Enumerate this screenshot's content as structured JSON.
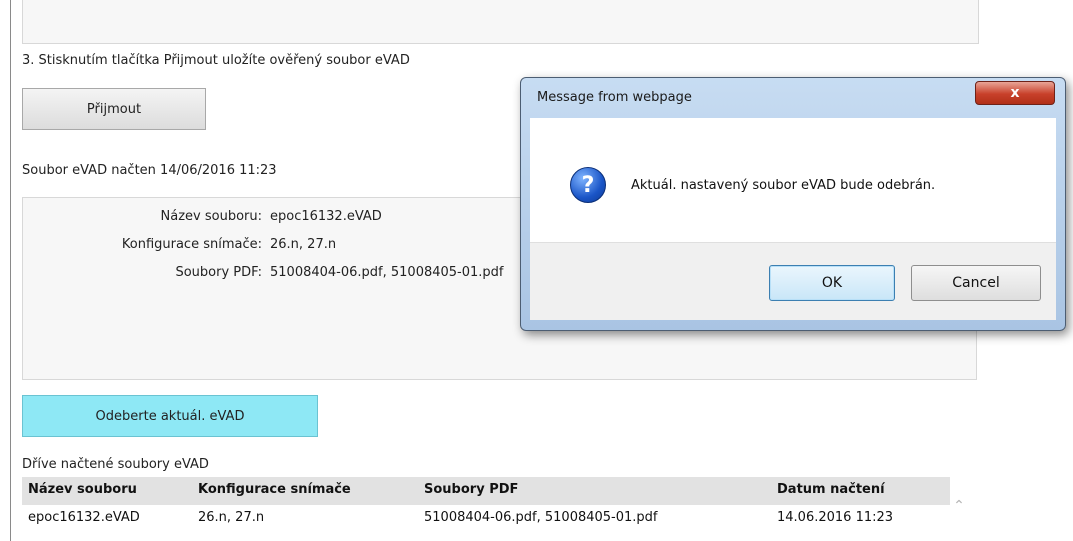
{
  "page": {
    "step3_text": "3. Stisknutím tlačítka Přijmout uložíte ověřený soubor eVAD",
    "accept_button": "Přijmout",
    "loaded_status": "Soubor eVAD načten 14/06/2016 11:23",
    "info": {
      "filename_label": "Název souboru:",
      "filename_value": "epoc16132.eVAD",
      "config_label": "Konfigurace snímače:",
      "config_value": "26.n, 27.n",
      "pdf_label": "Soubory PDF:",
      "pdf_value": "51008404-06.pdf, 51008405-01.pdf"
    },
    "remove_button": "Odeberte aktuál. eVAD",
    "history_title": "Dříve načtené soubory eVAD",
    "history_columns": [
      "Název souboru",
      "Konfigurace snímače",
      "Soubory PDF",
      "Datum načtení"
    ],
    "history_rows": [
      [
        "epoc16132.eVAD",
        "26.n, 27.n",
        "51008404-06.pdf, 51008405-01.pdf",
        "14.06.2016 11:23"
      ]
    ]
  },
  "dialog": {
    "title": "Message from webpage",
    "close_glyph": "x",
    "icon": "question-icon",
    "message": "Aktuál. nastavený soubor eVAD bude odebrán.",
    "ok_label": "OK",
    "cancel_label": "Cancel"
  },
  "colors": {
    "remove_button_bg": "#8ee8f5",
    "dialog_frame": "#a9c4e3",
    "close_button": "#c8402a"
  }
}
